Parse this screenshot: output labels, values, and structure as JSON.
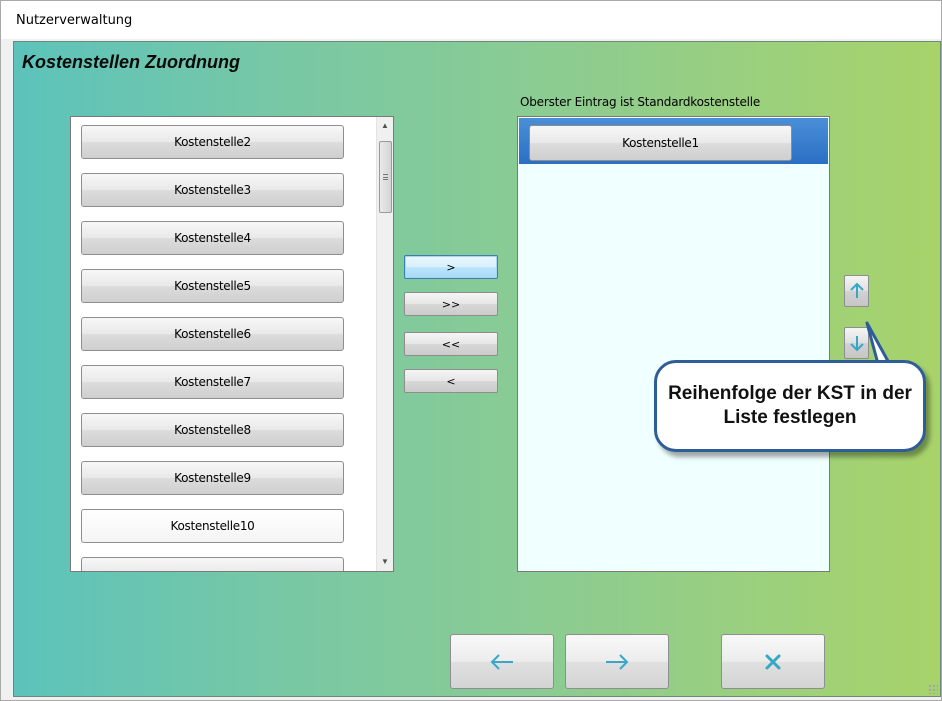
{
  "window": {
    "title": "Nutzerverwaltung"
  },
  "main": {
    "heading": "Kostenstellen Zuordnung",
    "available_list": {
      "items": [
        "Kostenstelle2",
        "Kostenstelle3",
        "Kostenstelle4",
        "Kostenstelle5",
        "Kostenstelle6",
        "Kostenstelle7",
        "Kostenstelle8",
        "Kostenstelle9",
        "Kostenstelle10"
      ]
    },
    "move_buttons": {
      "add_one": ">",
      "add_all": ">>",
      "remove_all": "<<",
      "remove_one": "<"
    },
    "assigned_list": {
      "label": "Oberster Eintrag ist Standardkostenstelle",
      "items": [
        "Kostenstelle1"
      ]
    },
    "order_buttons": {
      "up_icon": "arrow-up-icon",
      "down_icon": "arrow-down-icon"
    },
    "callout": {
      "text": "Reihenfolge der KST in der Liste festlegen"
    },
    "footer": {
      "back_icon": "arrow-left-icon",
      "next_icon": "arrow-right-icon",
      "cancel_icon": "close-icon"
    }
  },
  "colors": {
    "gradient_start": "#5cc3bb",
    "gradient_end": "#a8d36a",
    "selection": "#2b6fc4",
    "icon_accent": "#36a8c6",
    "callout_border": "#2f5d98"
  }
}
